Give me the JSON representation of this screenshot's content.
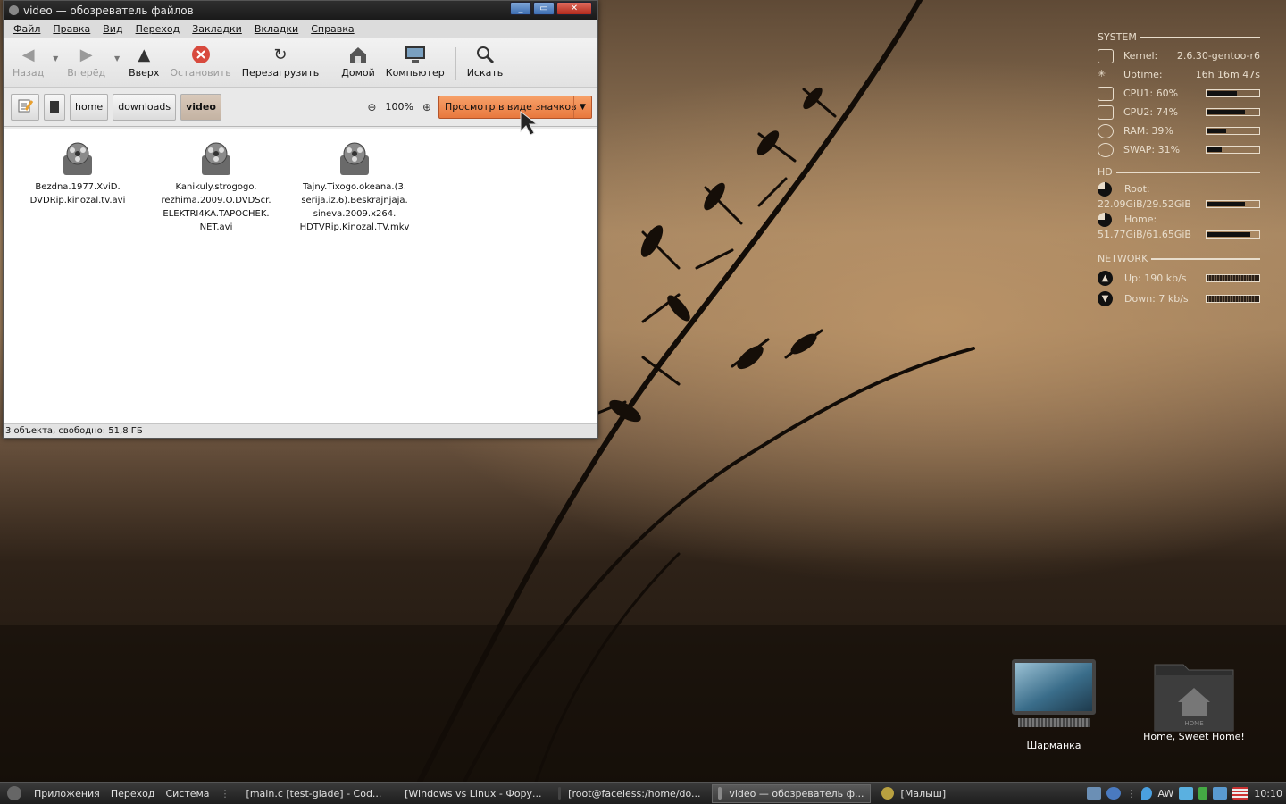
{
  "window": {
    "title": "video — обозреватель файлов",
    "menu": [
      "Файл",
      "Правка",
      "Вид",
      "Переход",
      "Закладки",
      "Вкладки",
      "Справка"
    ],
    "toolbar": {
      "back": "Назад",
      "forward": "Вперёд",
      "up": "Вверх",
      "stop": "Остановить",
      "reload": "Перезагрузить",
      "home": "Домой",
      "computer": "Компьютер",
      "search": "Искать"
    },
    "location": {
      "crumbs": [
        "home",
        "downloads",
        "video"
      ],
      "zoom": "100%",
      "view_mode": "Просмотр в виде значков"
    },
    "files": [
      "Bezdna.1977.XviD.\nDVDRip.kinozal.tv.avi",
      "Kanikuly.strogogo.\nrezhima.2009.O.DVDScr.\nELEKTRI4KA.TAPOCHEK.\nNET.avi",
      "Tajny.Tixogo.okeana.(3.\nserija.iz.6).Beskrajnjaja.\nsineva.2009.x264.\nHDTVRip.Kinozal.TV.mkv"
    ],
    "status": "3 объекта, свободно: 51,8 ГБ"
  },
  "conky": {
    "system_title": "SYSTEM",
    "kernel_label": "Kernel:",
    "kernel": "2.6.30-gentoo-r6",
    "uptime_label": "Uptime:",
    "uptime": "16h 16m 47s",
    "cpu1": "CPU1: 60%",
    "cpu2": "CPU2: 74%",
    "ram": "RAM: 39%",
    "swap": "SWAP: 31%",
    "cpu1_level": 0.6,
    "cpu2_level": 0.74,
    "ram_level": 0.39,
    "swap_level": 0.31,
    "hd_title": "HD",
    "root_label": "Root:",
    "root": "22.09GiB/29.52GiB",
    "root_level": 0.75,
    "home_label": "Home:",
    "home": "51.77GiB/61.65GiB",
    "home_level": 0.84,
    "net_title": "NETWORK",
    "up": "Up: 190 kb/s",
    "down": "Down: 7 kb/s"
  },
  "desktop": {
    "icon1": "Шарманка",
    "icon2": "Home, Sweet Home!",
    "folder_text": "HOME"
  },
  "taskbar": {
    "menus": [
      "Приложения",
      "Переход",
      "Система"
    ],
    "tasks": [
      "[main.c [test-glade] - Cod...",
      "[Windows vs Linux - Фору...",
      "[root@faceless:/home/do...",
      "video — обозреватель ф...",
      "[Малыш]"
    ],
    "tray_text": "AW",
    "clock": "10:10"
  }
}
